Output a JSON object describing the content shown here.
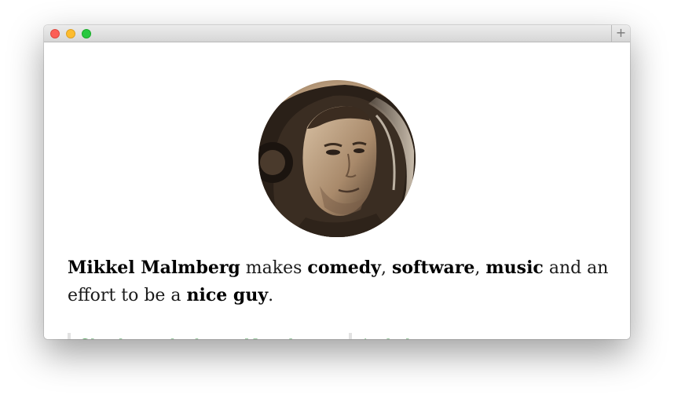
{
  "window": {
    "controls": [
      "close",
      "minimize",
      "zoom"
    ],
    "new_tab_label": "+"
  },
  "profile": {
    "avatar_icon": "astronaut-portrait-photo",
    "bio": {
      "name": "Mikkel Malmberg",
      "t1": " makes ",
      "w1": "comedy",
      "t2": ", ",
      "w2": "software",
      "t3": ", ",
      "w3": "music",
      "t4": " and an effort to be a ",
      "w4": "nice guy",
      "t5": "."
    }
  },
  "links": [
    {
      "label": "Check out the latest Newsletter"
    },
    {
      "label": "And also..."
    }
  ],
  "colors": {
    "link": "#2e8b3a",
    "text": "#1a1a1a"
  }
}
